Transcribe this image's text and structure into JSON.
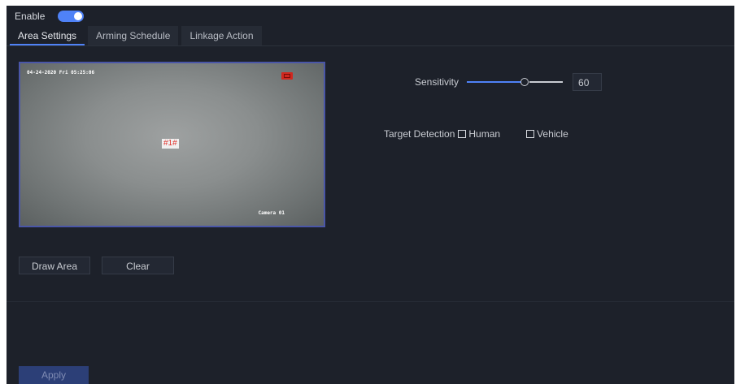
{
  "enable": {
    "label": "Enable",
    "on": true
  },
  "tabs": [
    {
      "label": "Area Settings",
      "active": true
    },
    {
      "label": "Arming Schedule",
      "active": false
    },
    {
      "label": "Linkage Action",
      "active": false
    }
  ],
  "video": {
    "timestamp": "04-24-2020 Fri 05:25:06",
    "camera_name": "Camera 01",
    "zone_label": "#1#"
  },
  "buttons": {
    "draw_area": "Draw Area",
    "clear": "Clear",
    "apply": "Apply"
  },
  "sensitivity": {
    "label": "Sensitivity",
    "value": "60",
    "max": 100
  },
  "target_detection": {
    "label": "Target Detection",
    "options": [
      {
        "label": "Human",
        "checked": false
      },
      {
        "label": "Vehicle",
        "checked": false
      }
    ]
  },
  "colors": {
    "accent": "#4f82f7",
    "background": "#1d212a",
    "record": "#d0281f",
    "apply_bg": "#2c3f77"
  },
  "icons": {
    "record": "record-icon",
    "toggle": "toggle-switch"
  }
}
